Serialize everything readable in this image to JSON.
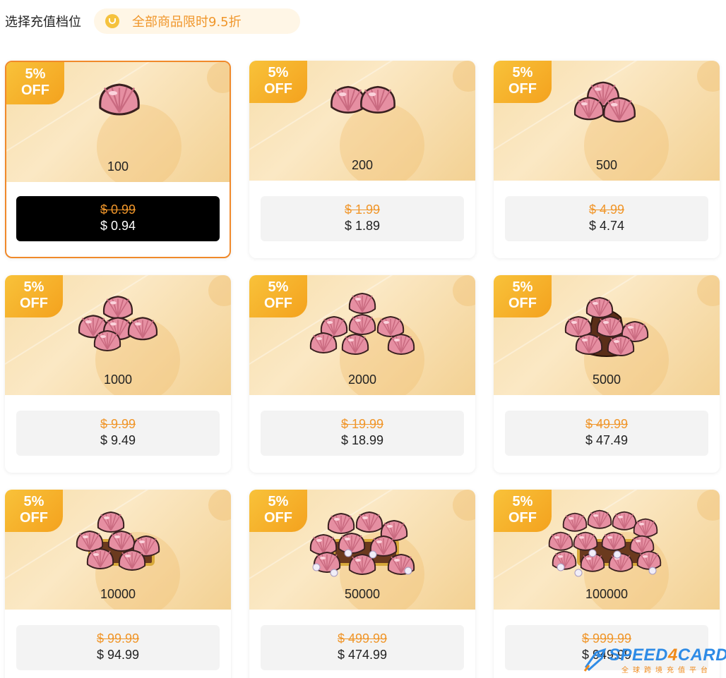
{
  "header": {
    "title": "选择充值档位",
    "promo_icon": "discount-bag-icon",
    "promo_text": "全部商品限时9.5折"
  },
  "colors": {
    "accent": "#f0962a",
    "badge": "#f4a21e",
    "selected_border": "#f0892a",
    "card_top": "#f7dfad",
    "shell": "#e58a9c"
  },
  "packages": [
    {
      "badge_percent": "5%",
      "badge_off": "OFF",
      "amount": "100",
      "original_price": "$ 0.99",
      "sale_price": "$ 0.94",
      "selected": true
    },
    {
      "badge_percent": "5%",
      "badge_off": "OFF",
      "amount": "200",
      "original_price": "$ 1.99",
      "sale_price": "$ 1.89",
      "selected": false
    },
    {
      "badge_percent": "5%",
      "badge_off": "OFF",
      "amount": "500",
      "original_price": "$ 4.99",
      "sale_price": "$ 4.74",
      "selected": false
    },
    {
      "badge_percent": "5%",
      "badge_off": "OFF",
      "amount": "1000",
      "original_price": "$ 9.99",
      "sale_price": "$ 9.49",
      "selected": false
    },
    {
      "badge_percent": "5%",
      "badge_off": "OFF",
      "amount": "2000",
      "original_price": "$ 19.99",
      "sale_price": "$ 18.99",
      "selected": false
    },
    {
      "badge_percent": "5%",
      "badge_off": "OFF",
      "amount": "5000",
      "original_price": "$ 49.99",
      "sale_price": "$ 47.49",
      "selected": false
    },
    {
      "badge_percent": "5%",
      "badge_off": "OFF",
      "amount": "10000",
      "original_price": "$ 99.99",
      "sale_price": "$ 94.99",
      "selected": false
    },
    {
      "badge_percent": "5%",
      "badge_off": "OFF",
      "amount": "50000",
      "original_price": "$ 499.99",
      "sale_price": "$ 474.99",
      "selected": false
    },
    {
      "badge_percent": "5%",
      "badge_off": "OFF",
      "amount": "100000",
      "original_price": "$ 999.99",
      "sale_price": "$ 949.99",
      "selected": false
    }
  ],
  "watermark": {
    "brand_a": "SPEED",
    "brand_b": "4",
    "brand_c": "CARD",
    "subtitle": "全球跨境充值平台"
  }
}
